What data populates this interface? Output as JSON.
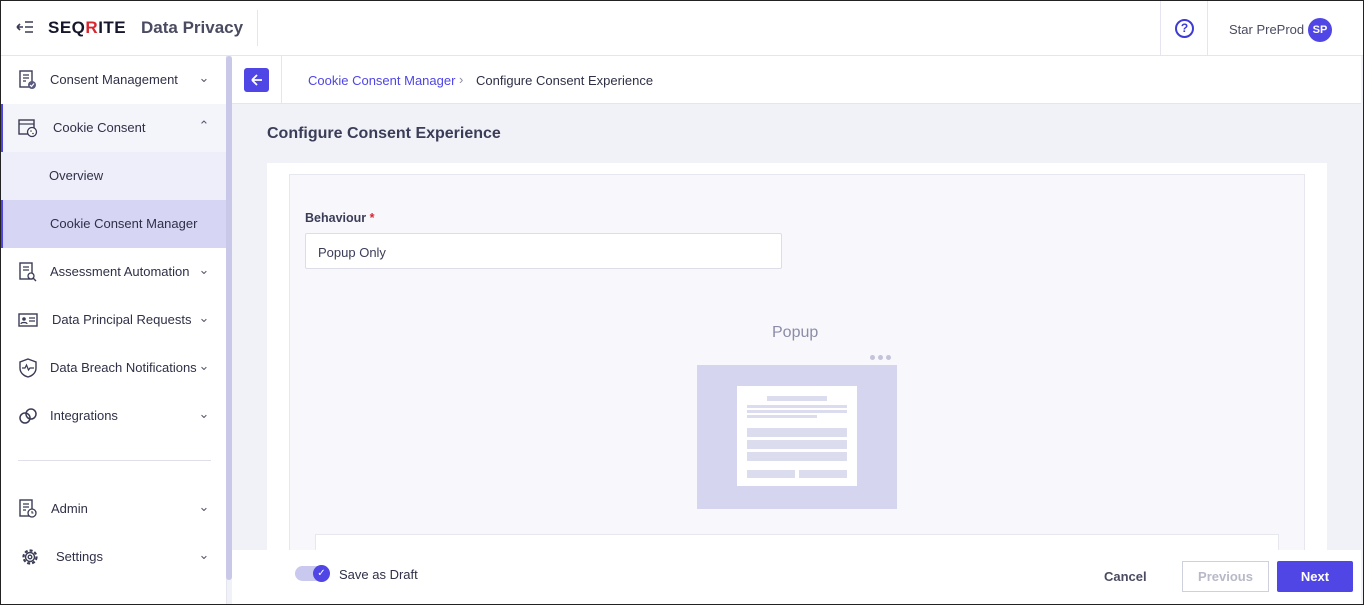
{
  "header": {
    "brand_prefix": "SEQ",
    "brand_mark": "R",
    "brand_suffix": "ITE",
    "app_title": "Data Privacy",
    "user_name": "Star PreProd",
    "avatar_initials": "SP",
    "collapse_icon": "collapse-menu-icon",
    "help_icon": "help-circle-icon"
  },
  "sidebar": {
    "items": [
      {
        "label": "Consent Management",
        "icon": "document-check-icon"
      },
      {
        "label": "Cookie Consent",
        "icon": "cookie-window-icon"
      },
      {
        "label": "Overview"
      },
      {
        "label": "Cookie Consent Manager"
      },
      {
        "label": "Assessment Automation",
        "icon": "document-search-icon"
      },
      {
        "label": "Data Principal Requests",
        "icon": "id-card-icon"
      },
      {
        "label": "Data Breach Notifications",
        "icon": "shield-pulse-icon"
      },
      {
        "label": "Integrations",
        "icon": "link-icon"
      },
      {
        "label": "Admin",
        "icon": "document-clock-icon"
      },
      {
        "label": "Settings",
        "icon": "gear-icon"
      }
    ]
  },
  "breadcrumb": {
    "parent": "Cookie Consent Manager",
    "current": "Configure Consent Experience"
  },
  "page": {
    "title": "Configure Consent Experience",
    "behaviour_label": "Behaviour",
    "required_mark": "*",
    "behaviour_value": "Popup Only",
    "preview_title": "Popup"
  },
  "footer": {
    "draft_label": "Save as Draft",
    "cancel_label": "Cancel",
    "previous_label": "Previous",
    "next_label": "Next"
  },
  "colors": {
    "accent": "#4f46e5",
    "brand_red": "#d8262f",
    "selected_bg": "#d6d5f3"
  }
}
